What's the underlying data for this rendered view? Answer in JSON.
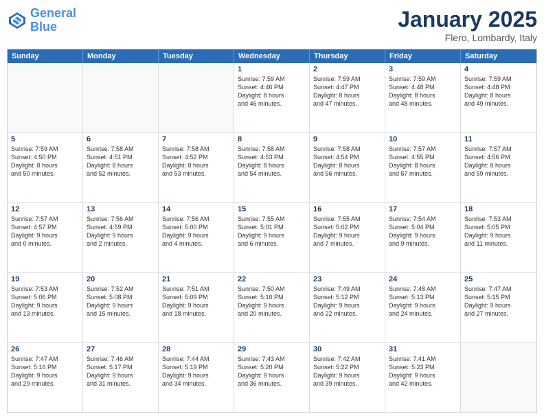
{
  "header": {
    "logo_line1": "General",
    "logo_line2": "Blue",
    "month": "January 2025",
    "location": "Flero, Lombardy, Italy"
  },
  "weekdays": [
    "Sunday",
    "Monday",
    "Tuesday",
    "Wednesday",
    "Thursday",
    "Friday",
    "Saturday"
  ],
  "rows": [
    [
      {
        "day": "",
        "text": ""
      },
      {
        "day": "",
        "text": ""
      },
      {
        "day": "",
        "text": ""
      },
      {
        "day": "1",
        "text": "Sunrise: 7:59 AM\nSunset: 4:46 PM\nDaylight: 8 hours\nand 46 minutes."
      },
      {
        "day": "2",
        "text": "Sunrise: 7:59 AM\nSunset: 4:47 PM\nDaylight: 8 hours\nand 47 minutes."
      },
      {
        "day": "3",
        "text": "Sunrise: 7:59 AM\nSunset: 4:48 PM\nDaylight: 8 hours\nand 48 minutes."
      },
      {
        "day": "4",
        "text": "Sunrise: 7:59 AM\nSunset: 4:48 PM\nDaylight: 8 hours\nand 49 minutes."
      }
    ],
    [
      {
        "day": "5",
        "text": "Sunrise: 7:59 AM\nSunset: 4:50 PM\nDaylight: 8 hours\nand 50 minutes."
      },
      {
        "day": "6",
        "text": "Sunrise: 7:58 AM\nSunset: 4:51 PM\nDaylight: 8 hours\nand 52 minutes."
      },
      {
        "day": "7",
        "text": "Sunrise: 7:58 AM\nSunset: 4:52 PM\nDaylight: 8 hours\nand 53 minutes."
      },
      {
        "day": "8",
        "text": "Sunrise: 7:58 AM\nSunset: 4:53 PM\nDaylight: 8 hours\nand 54 minutes."
      },
      {
        "day": "9",
        "text": "Sunrise: 7:58 AM\nSunset: 4:54 PM\nDaylight: 8 hours\nand 56 minutes."
      },
      {
        "day": "10",
        "text": "Sunrise: 7:57 AM\nSunset: 4:55 PM\nDaylight: 8 hours\nand 57 minutes."
      },
      {
        "day": "11",
        "text": "Sunrise: 7:57 AM\nSunset: 4:56 PM\nDaylight: 8 hours\nand 59 minutes."
      }
    ],
    [
      {
        "day": "12",
        "text": "Sunrise: 7:57 AM\nSunset: 4:57 PM\nDaylight: 9 hours\nand 0 minutes."
      },
      {
        "day": "13",
        "text": "Sunrise: 7:56 AM\nSunset: 4:59 PM\nDaylight: 9 hours\nand 2 minutes."
      },
      {
        "day": "14",
        "text": "Sunrise: 7:56 AM\nSunset: 5:00 PM\nDaylight: 9 hours\nand 4 minutes."
      },
      {
        "day": "15",
        "text": "Sunrise: 7:55 AM\nSunset: 5:01 PM\nDaylight: 9 hours\nand 6 minutes."
      },
      {
        "day": "16",
        "text": "Sunrise: 7:55 AM\nSunset: 5:02 PM\nDaylight: 9 hours\nand 7 minutes."
      },
      {
        "day": "17",
        "text": "Sunrise: 7:54 AM\nSunset: 5:04 PM\nDaylight: 9 hours\nand 9 minutes."
      },
      {
        "day": "18",
        "text": "Sunrise: 7:53 AM\nSunset: 5:05 PM\nDaylight: 9 hours\nand 11 minutes."
      }
    ],
    [
      {
        "day": "19",
        "text": "Sunrise: 7:53 AM\nSunset: 5:06 PM\nDaylight: 9 hours\nand 13 minutes."
      },
      {
        "day": "20",
        "text": "Sunrise: 7:52 AM\nSunset: 5:08 PM\nDaylight: 9 hours\nand 15 minutes."
      },
      {
        "day": "21",
        "text": "Sunrise: 7:51 AM\nSunset: 5:09 PM\nDaylight: 9 hours\nand 18 minutes."
      },
      {
        "day": "22",
        "text": "Sunrise: 7:50 AM\nSunset: 5:10 PM\nDaylight: 9 hours\nand 20 minutes."
      },
      {
        "day": "23",
        "text": "Sunrise: 7:49 AM\nSunset: 5:12 PM\nDaylight: 9 hours\nand 22 minutes."
      },
      {
        "day": "24",
        "text": "Sunrise: 7:48 AM\nSunset: 5:13 PM\nDaylight: 9 hours\nand 24 minutes."
      },
      {
        "day": "25",
        "text": "Sunrise: 7:47 AM\nSunset: 5:15 PM\nDaylight: 9 hours\nand 27 minutes."
      }
    ],
    [
      {
        "day": "26",
        "text": "Sunrise: 7:47 AM\nSunset: 5:16 PM\nDaylight: 9 hours\nand 29 minutes."
      },
      {
        "day": "27",
        "text": "Sunrise: 7:46 AM\nSunset: 5:17 PM\nDaylight: 9 hours\nand 31 minutes."
      },
      {
        "day": "28",
        "text": "Sunrise: 7:44 AM\nSunset: 5:19 PM\nDaylight: 9 hours\nand 34 minutes."
      },
      {
        "day": "29",
        "text": "Sunrise: 7:43 AM\nSunset: 5:20 PM\nDaylight: 9 hours\nand 36 minutes."
      },
      {
        "day": "30",
        "text": "Sunrise: 7:42 AM\nSunset: 5:22 PM\nDaylight: 9 hours\nand 39 minutes."
      },
      {
        "day": "31",
        "text": "Sunrise: 7:41 AM\nSunset: 5:23 PM\nDaylight: 9 hours\nand 42 minutes."
      },
      {
        "day": "",
        "text": ""
      }
    ]
  ]
}
